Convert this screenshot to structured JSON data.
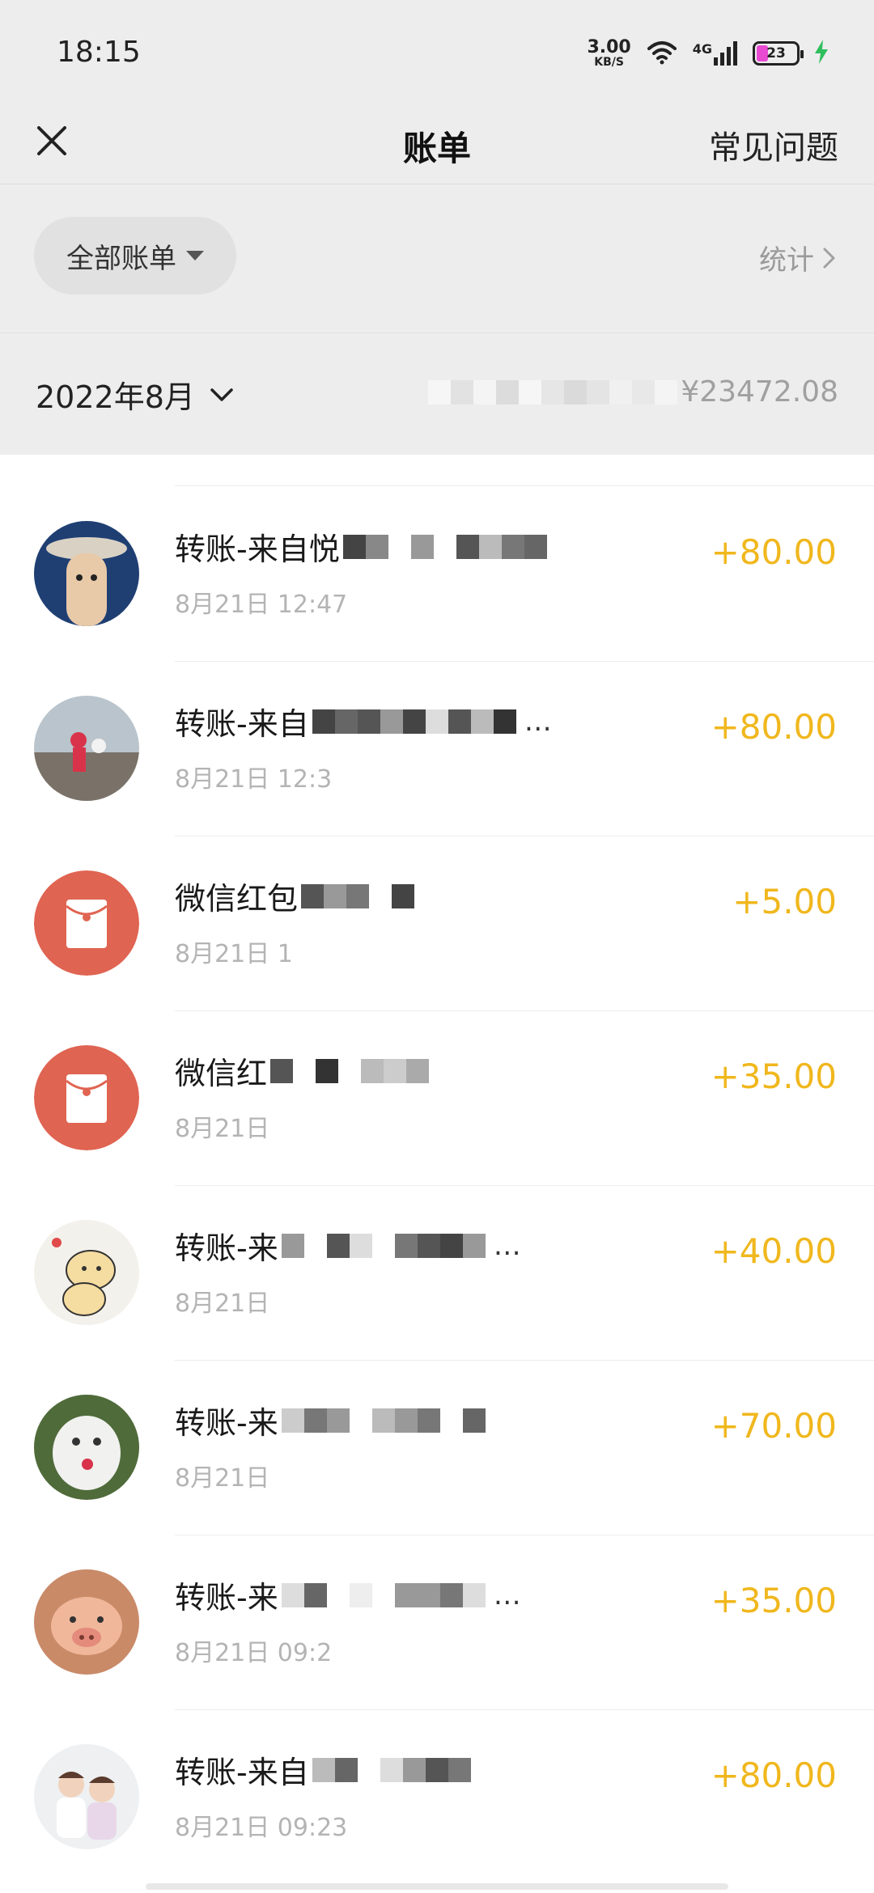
{
  "status_bar": {
    "time": "18:15",
    "net_speed_value": "3.00",
    "net_speed_unit": "KB/S",
    "network": "4G",
    "battery_level": "23",
    "icons": [
      "wifi-icon",
      "signal-icon",
      "battery-icon",
      "charging-bolt-icon"
    ]
  },
  "nav": {
    "close_icon": "close-icon",
    "title": "账单",
    "faq_label": "常见问题"
  },
  "filter": {
    "pill_label": "全部账单",
    "pill_icon": "triangle-down-icon",
    "stats_label": "统计",
    "stats_icon": "chevron-right-icon"
  },
  "month": {
    "label": "2022年8月",
    "icon": "chevron-down-icon",
    "total": "¥23472.08"
  },
  "colors": {
    "accent_amount": "#f0b71d",
    "red_packet": "#e06452",
    "background": "#ededed"
  },
  "transactions": [
    {
      "title": "转账-来自悦",
      "date": "8月21日 12:47",
      "amount": "+80.00",
      "avatar": "photo-avatar"
    },
    {
      "title": "转账-来自",
      "date": "8月21日 12:3",
      "amount": "+80.00",
      "avatar": "photo-avatar"
    },
    {
      "title": "微信红包",
      "date": "8月21日 1",
      "amount": "+5.00",
      "avatar": "red-packet-icon"
    },
    {
      "title": "微信红",
      "date": "8月21日",
      "amount": "+35.00",
      "avatar": "red-packet-icon"
    },
    {
      "title": "转账-来",
      "date": "8月21日",
      "amount": "+40.00",
      "avatar": "photo-avatar"
    },
    {
      "title": "转账-来",
      "date": "8月21日",
      "amount": "+70.00",
      "avatar": "photo-avatar"
    },
    {
      "title": "转账-来",
      "date": "8月21日 09:2",
      "amount": "+35.00",
      "avatar": "photo-avatar"
    },
    {
      "title": "转账-来自",
      "date": "8月21日 09:23",
      "amount": "+80.00",
      "avatar": "photo-avatar"
    }
  ]
}
